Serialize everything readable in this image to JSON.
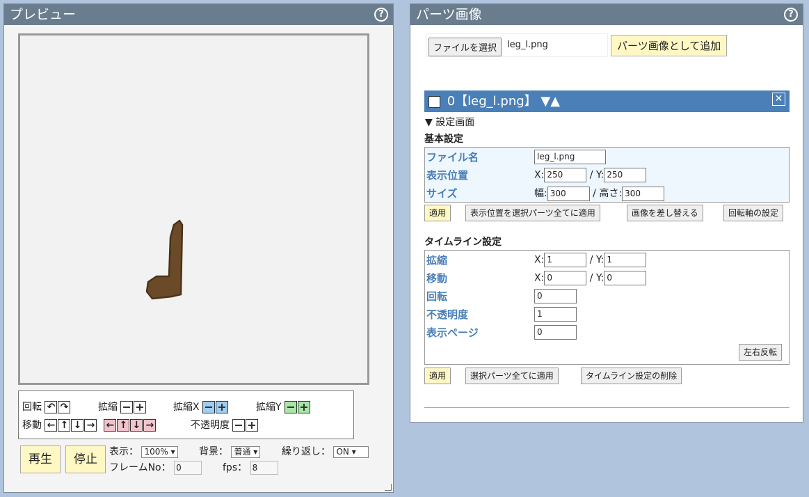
{
  "preview": {
    "title": "プレビュー",
    "help_label": "?",
    "rotate_label": "回転",
    "scale_label": "拡縮",
    "scale_x_label": "拡縮X",
    "scale_y_label": "拡縮Y",
    "move_label": "移動",
    "opacity_label": "不透明度",
    "play_label": "再生",
    "stop_label": "停止",
    "display_label": "表示：",
    "display_value": "100%",
    "background_label": "背景：",
    "background_value": "普通",
    "loop_label": "繰り返し：",
    "loop_value": "ON",
    "frame_label": "フレームNo：",
    "frame_value": "0",
    "fps_label": "fps：",
    "fps_value": "8"
  },
  "parts": {
    "title": "パーツ画像",
    "help_label": "?",
    "choose_file_label": "ファイルを選択",
    "chosen_file": "leg_l.png",
    "add_button_label": "パーツ画像として追加",
    "part_header": "0【leg_l.png】",
    "settings_toggle": "▼ 設定画面",
    "basic_section": "基本設定",
    "filename_label": "ファイル名",
    "filename_value": "leg_l.png",
    "position_label": "表示位置",
    "pos_x_label": "X:",
    "pos_x": "250",
    "pos_y_label": "/ Y:",
    "pos_y": "250",
    "size_label": "サイズ",
    "width_label": "幅:",
    "width_value": "300",
    "height_label": "/ 高さ:",
    "height_value": "300",
    "apply_label": "適用",
    "apply_pos_all_label": "表示位置を選択パーツ全てに適用",
    "replace_image_label": "画像を差し替える",
    "pivot_label": "回転軸の設定",
    "timeline_section": "タイムライン設定",
    "tl_scale_label": "拡縮",
    "tl_scale_x_label": "X:",
    "tl_scale_x": "1",
    "tl_scale_y_label": "/ Y:",
    "tl_scale_y": "1",
    "tl_move_label": "移動",
    "tl_move_x_label": "X:",
    "tl_move_x": "0",
    "tl_move_y_label": "/ Y:",
    "tl_move_y": "0",
    "tl_rotate_label": "回転",
    "tl_rotate": "0",
    "tl_opacity_label": "不透明度",
    "tl_opacity": "1",
    "tl_page_label": "表示ページ",
    "tl_page": "0",
    "flip_label": "左右反転",
    "tl_apply_label": "適用",
    "tl_apply_all_label": "選択パーツ全てに適用",
    "tl_delete_label": "タイムライン設定の削除"
  },
  "colors": {
    "title_bar": "#6a7d8e",
    "part_bar": "#4a7fb8",
    "leg_fill": "#6b4a2a",
    "leg_stroke": "#4a3418",
    "apply_button": "#fff8c4"
  }
}
